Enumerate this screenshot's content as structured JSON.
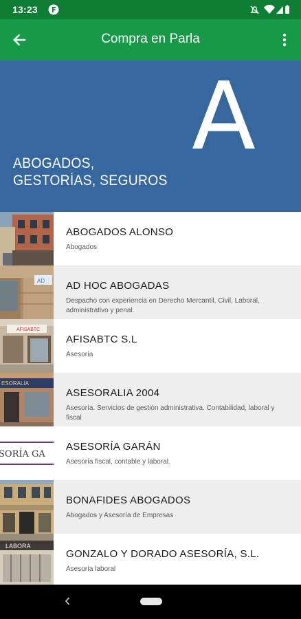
{
  "status_bar": {
    "time": "13:23",
    "app_icon": "f-circle-icon",
    "icons": [
      "notifications-off-icon",
      "wifi-icon",
      "signal-icon",
      "battery-icon"
    ]
  },
  "app_bar": {
    "title": "Compra en Parla",
    "back_icon": "arrow-back-icon",
    "menu_icon": "more-vert-icon",
    "color": "#169a47",
    "status_color": "#0e7e34"
  },
  "hero": {
    "letter": "A",
    "line1": "ABOGADOS,",
    "line2": "GESTORÍAS, SEGUROS",
    "color": "#36679f"
  },
  "items": [
    {
      "title": "ABOGADOS ALONSO",
      "desc": "Abogados"
    },
    {
      "title": "AD HOC ABOGADAS",
      "desc": "Despacho con experiencia en Derecho Mercantil, Civil, Laboral, administrativo y penal."
    },
    {
      "title": "AFISABTC S.L",
      "desc": "Asesoría"
    },
    {
      "title": "ASESORALIA 2004",
      "desc": "Asesoría. Servicios de gestión administrativa. Contabilidad, laboral y fiscal"
    },
    {
      "title": "ASESORÍA GARÁN",
      "desc": "Asesoría fiscal, contable y laboral."
    },
    {
      "title": "BONAFIDES ABOGADOS",
      "desc": "Abogados y Asesoría de Empresas"
    },
    {
      "title": "GONZALO Y DORADO ASESORÍA, S.L.",
      "desc": "Asesoría laboral"
    }
  ],
  "thumbs": {
    "ad_hoc_sign": "AD",
    "asesoralia_sign": "ESORALIA",
    "afisabtc_sign": "AFISABTC",
    "garan_sign": "SORÍA GA",
    "gonzalo_sign": "LABORA"
  },
  "nav_bar": {
    "back_icon": "nav-back-icon",
    "home_icon": "nav-home-pill"
  }
}
